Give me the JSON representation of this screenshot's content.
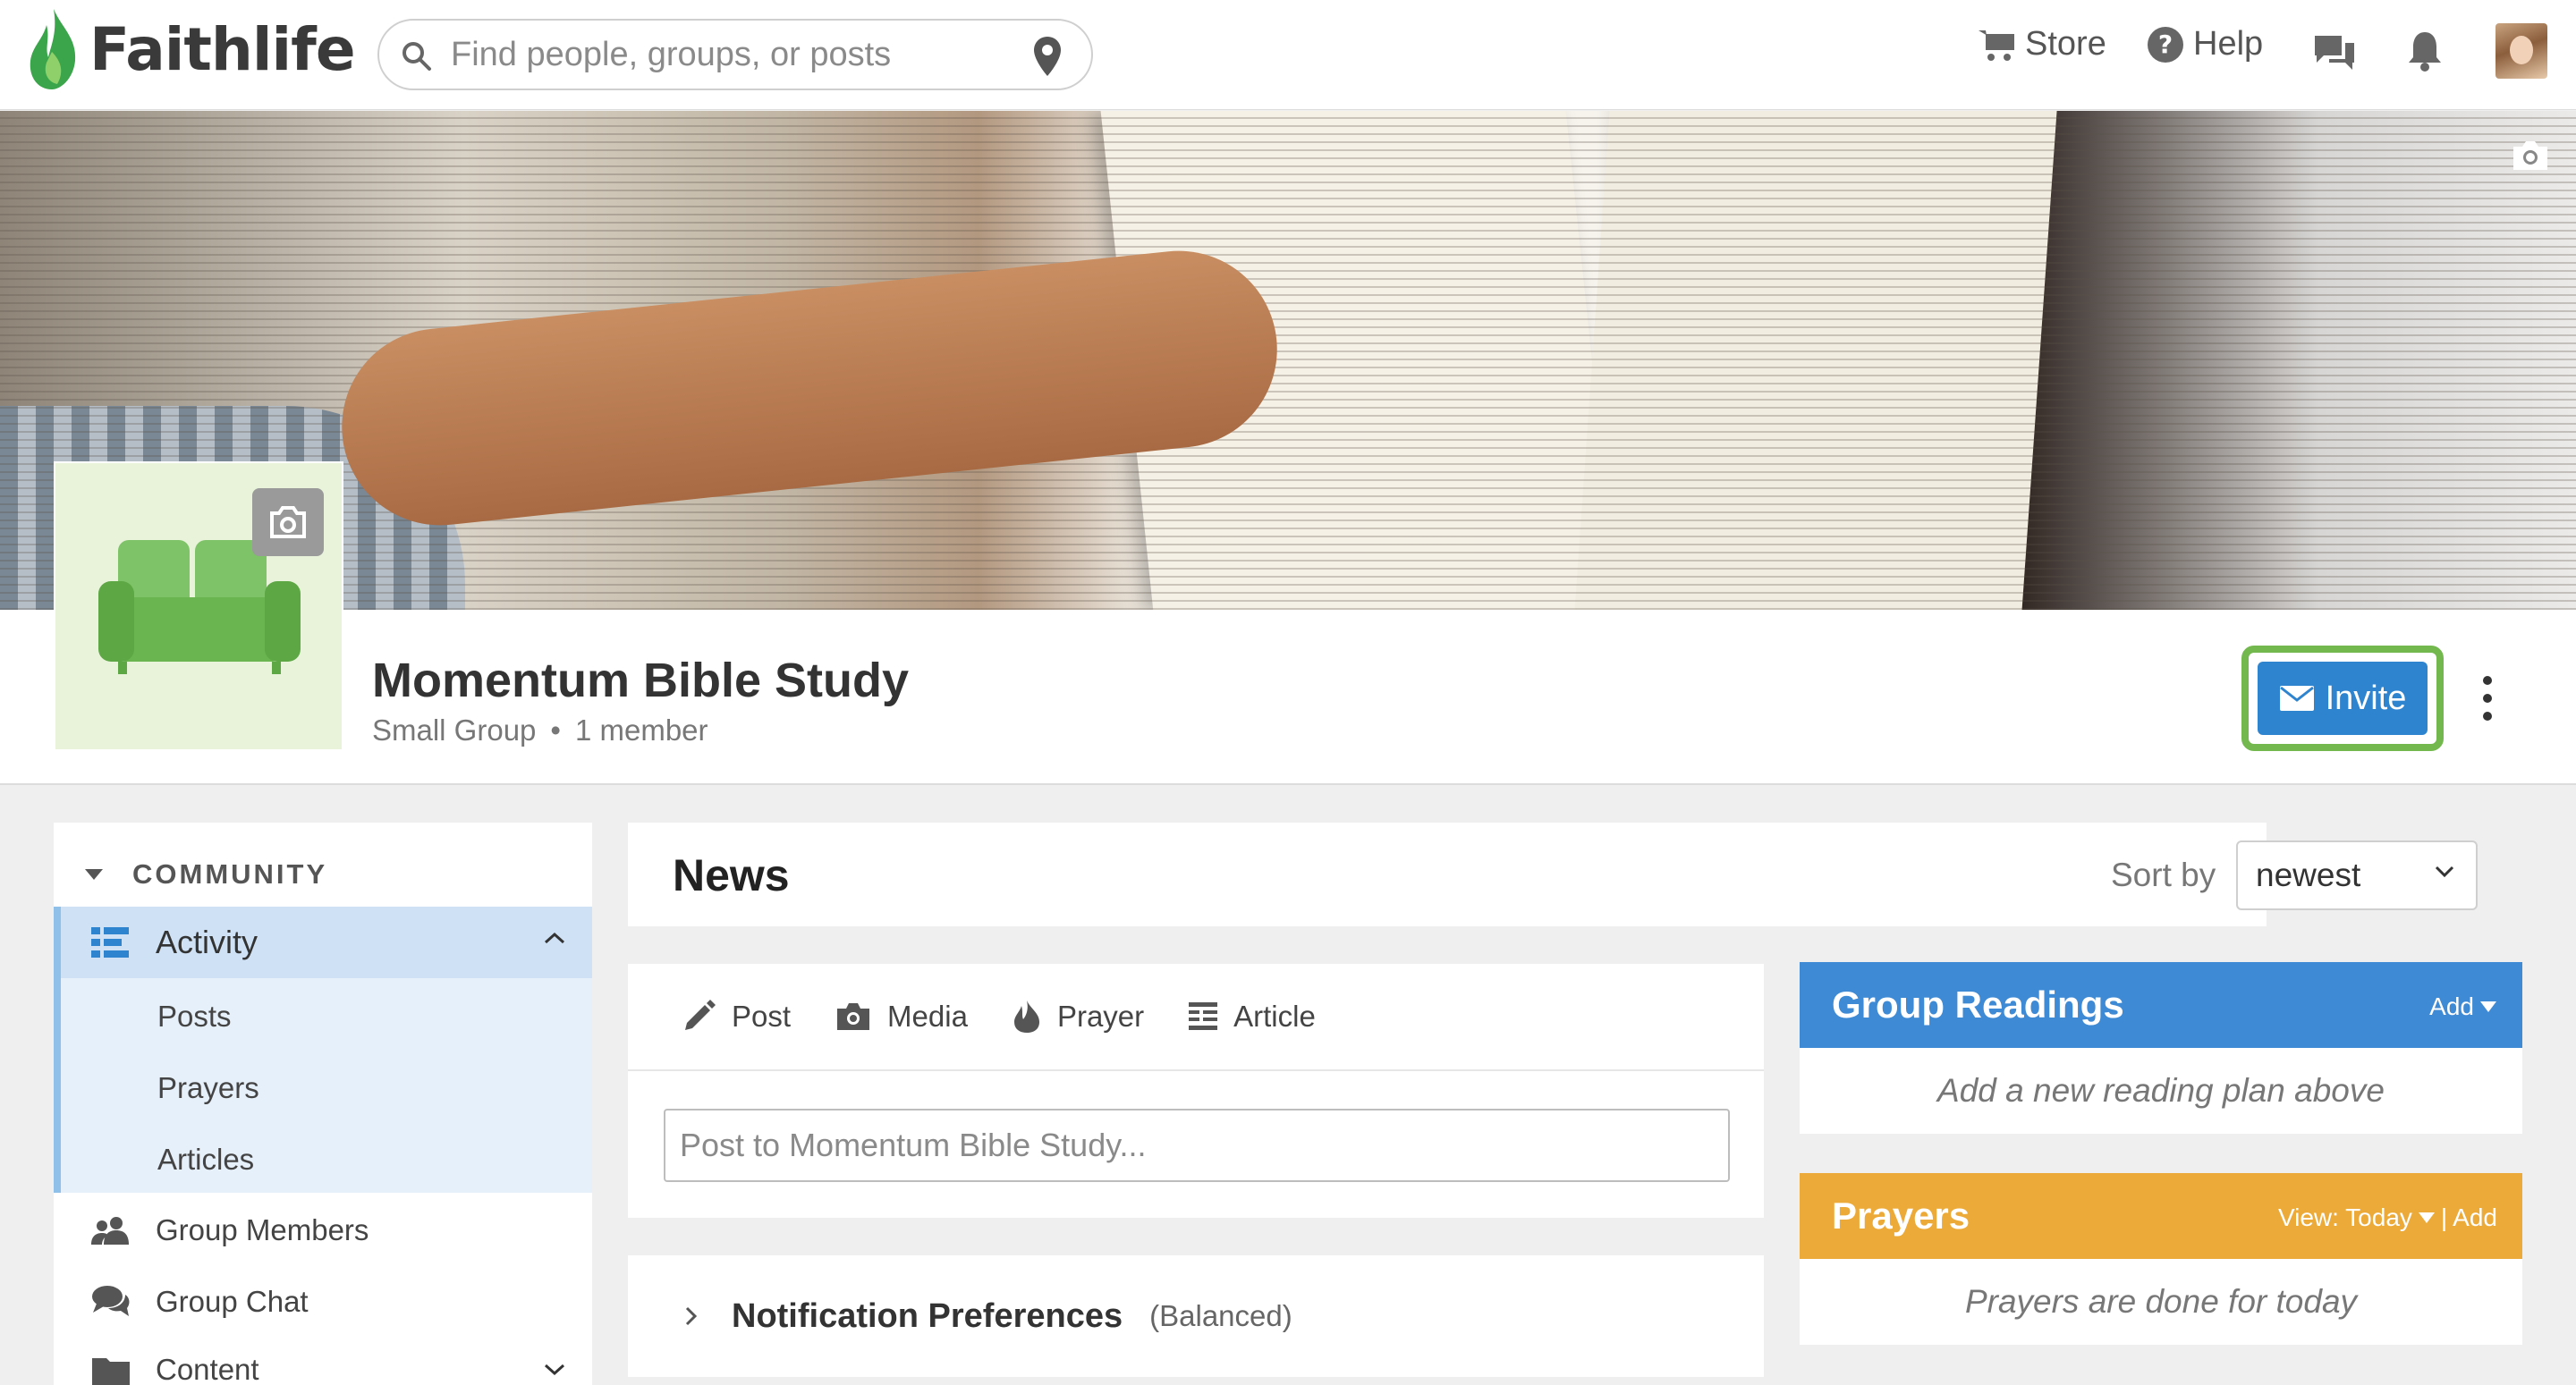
{
  "topbar": {
    "logo_text": "Faithlife",
    "search_placeholder": "Find people, groups, or posts",
    "nav": {
      "store": "Store",
      "help": "Help"
    },
    "icons": [
      "search-icon",
      "location-pin-icon",
      "cart-icon",
      "help-icon",
      "chat-icon",
      "bell-icon"
    ]
  },
  "group": {
    "name": "Momentum Bible Study",
    "type": "Small Group",
    "separator": "•",
    "members": "1 member",
    "invite_label": "Invite"
  },
  "sidebar": {
    "heading": "COMMUNITY",
    "active": "Activity",
    "sub_items": [
      "Posts",
      "Prayers",
      "Articles"
    ],
    "items": [
      "Group Members",
      "Group Chat",
      "Content"
    ]
  },
  "news": {
    "title": "News",
    "sort_label": "Sort by",
    "sort_value": "newest"
  },
  "composer": {
    "tabs": [
      "Post",
      "Media",
      "Prayer",
      "Article"
    ],
    "placeholder": "Post to Momentum Bible Study..."
  },
  "notifications": {
    "title": "Notification Preferences",
    "level": "(Balanced)"
  },
  "widgets": {
    "readings": {
      "title": "Group Readings",
      "add": "Add",
      "empty": "Add a new reading plan above"
    },
    "prayers": {
      "title": "Prayers",
      "view": "View: Today",
      "add": "Add",
      "divider": "|",
      "empty": "Prayers are done for today"
    }
  },
  "colors": {
    "accent_blue": "#2f84d0",
    "invite_highlight": "#72b84e",
    "readings_header": "#3f8ad4",
    "prayers_header": "#ecaa38",
    "logo_green": "#3aa54a"
  }
}
